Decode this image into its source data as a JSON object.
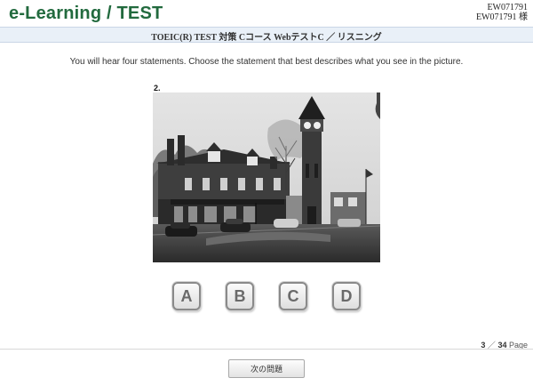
{
  "header": {
    "logo": "e-Learning / TEST",
    "user_id": "EW071791",
    "user_name": "EW071791 様"
  },
  "test": {
    "title": "TOEIC(R) TEST 対策 Cコース WebテストC ／ リスニング",
    "instruction": "You will hear four statements. Choose the statement that best describes what you see in the picture.",
    "question_number": "2."
  },
  "answers": [
    {
      "label": "A"
    },
    {
      "label": "B"
    },
    {
      "label": "C"
    },
    {
      "label": "D"
    }
  ],
  "pagination": {
    "current": "3",
    "separator": "／",
    "total": "34",
    "unit": "Page"
  },
  "footer": {
    "next_label": "次の問題"
  }
}
